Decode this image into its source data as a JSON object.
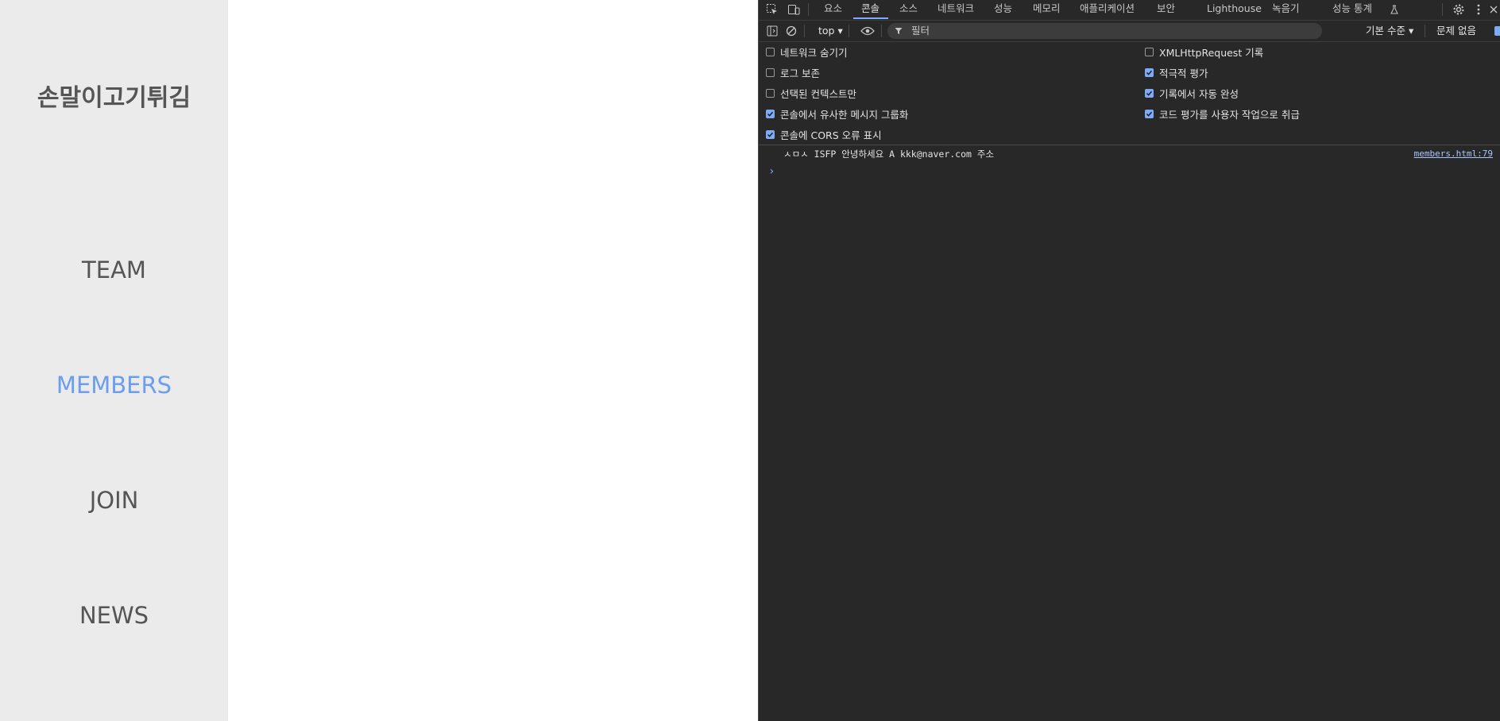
{
  "page": {
    "brand": "손말이고기튀김",
    "nav": [
      {
        "label": "TEAM",
        "active": false
      },
      {
        "label": "MEMBERS",
        "active": true
      },
      {
        "label": "JOIN",
        "active": false
      },
      {
        "label": "NEWS",
        "active": false
      }
    ],
    "colors": {
      "sidebar_bg": "#ebebeb",
      "nav_text": "#555555",
      "nav_active": "#6b9ef0"
    }
  },
  "devtools": {
    "tabs": [
      "요소",
      "콘솔",
      "소스",
      "네트워크",
      "성능",
      "메모리",
      "애플리케이션",
      "보안",
      "Lighthouse",
      "녹음기",
      "성능 통계"
    ],
    "active_tab": "콘솔",
    "toolbar": {
      "context": "top",
      "filter_placeholder": "필터",
      "level": "기본 수준",
      "issues": "문제 없음"
    },
    "settings_left": [
      {
        "label": "네트워크 숨기기",
        "checked": false
      },
      {
        "label": "로그 보존",
        "checked": false
      },
      {
        "label": "선택된 컨텍스트만",
        "checked": false
      },
      {
        "label": "콘솔에서 유사한 메시지 그룹화",
        "checked": true
      },
      {
        "label": "콘솔에 CORS 오류 표시",
        "checked": true
      }
    ],
    "settings_right": [
      {
        "label": "XMLHttpRequest 기록",
        "checked": false
      },
      {
        "label": "적극적 평가",
        "checked": true
      },
      {
        "label": "기록에서 자동 완성",
        "checked": true
      },
      {
        "label": "코드 평가를 사용자 작업으로 취급",
        "checked": true
      }
    ],
    "console": {
      "message": "ㅅㅁㅅ ISFP 안녕하세요 A kkk@naver.com 주소",
      "source": "members.html:79",
      "prompt": "›"
    },
    "colors": {
      "bg": "#282828",
      "accent": "#7cacf8",
      "link": "#a8c7fa"
    }
  }
}
